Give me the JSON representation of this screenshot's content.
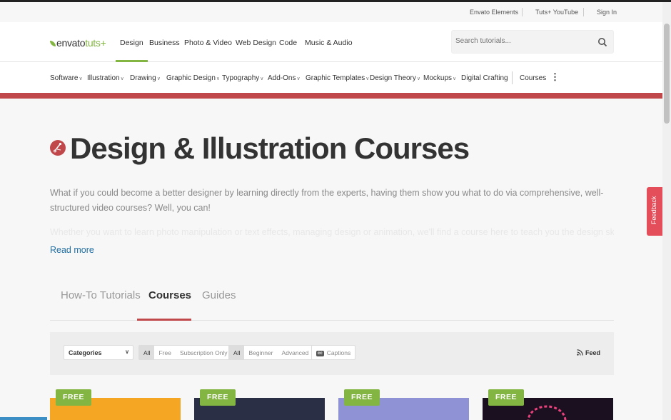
{
  "utility": {
    "links": [
      "Envato Elements",
      "Tuts+ YouTube",
      "Sign In"
    ]
  },
  "brand": {
    "envato": "envato",
    "tuts": "tuts+"
  },
  "nav": {
    "links": [
      "Design",
      "Business",
      "Photo & Video",
      "Web Design",
      "Code",
      "Music & Audio"
    ],
    "active": "Design"
  },
  "search": {
    "placeholder": "Search tutorials..."
  },
  "subnav": {
    "items": [
      "Software",
      "Illustration",
      "Drawing",
      "Graphic Design",
      "Typography",
      "Add-Ons",
      "Graphic Templates",
      "Design Theory",
      "Mockups",
      "Digital Crafting",
      "Courses"
    ],
    "has_dropdown": [
      true,
      true,
      true,
      true,
      true,
      true,
      true,
      true,
      true,
      false,
      false
    ]
  },
  "hero": {
    "title": "Design & Illustration Courses",
    "intro": "What if you could become a better designer by learning directly from the experts, having them show you what to do via comprehensive, well-structured video courses? Well, you can!",
    "faded_text": "Whether you want to learn photo manipulation or text effects, managing design or animation, we'll find a course here to teach you the design skills you need.",
    "read_more": "Read more"
  },
  "tabs": {
    "items": [
      "How-To Tutorials",
      "Courses",
      "Guides"
    ],
    "active": "Courses"
  },
  "filters": {
    "categories_label": "Categories",
    "price_options": [
      "All",
      "Free",
      "Subscription Only"
    ],
    "price_selected": "All",
    "level_options": [
      "All",
      "Beginner",
      "Advanced"
    ],
    "level_selected": "All",
    "captions_label": "Captions",
    "captions_icon": "cc",
    "feed_label": "Feed"
  },
  "cards": [
    {
      "badge": "FREE",
      "color": "#f5a623"
    },
    {
      "badge": "FREE",
      "color": "#2a2f45"
    },
    {
      "badge": "FREE",
      "color": "#8f93d6"
    },
    {
      "badge": "FREE",
      "color": "#1a1020"
    }
  ],
  "feedback": {
    "label": "Feedback"
  },
  "colors": {
    "accent": "#82b541",
    "brand_red": "#c0484b",
    "link": "#1f6ea3",
    "feedback": "#e44d5a"
  }
}
